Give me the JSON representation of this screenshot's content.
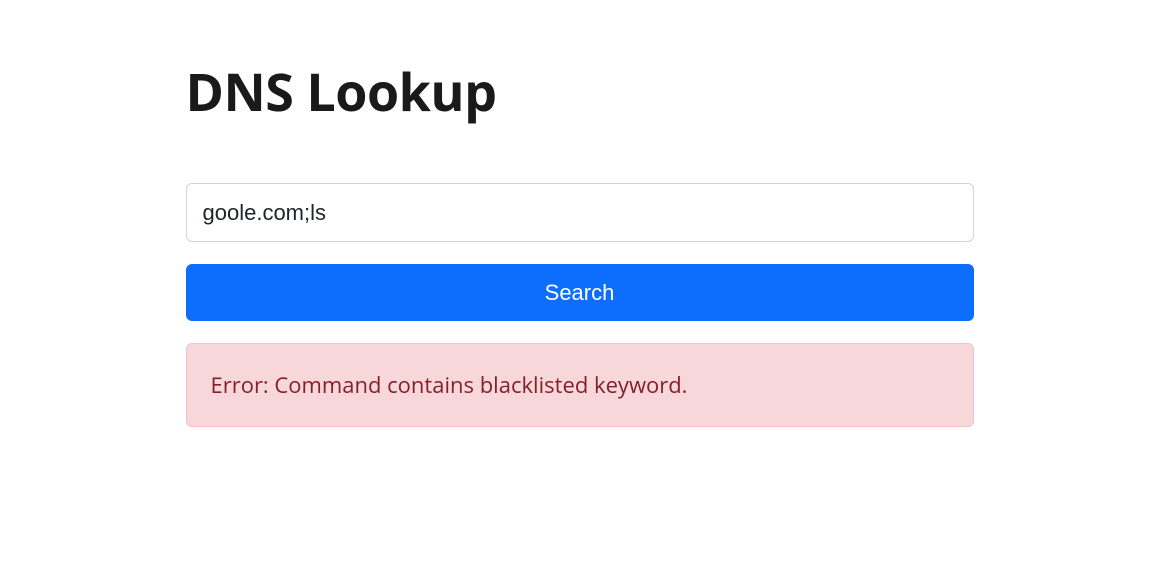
{
  "header": {
    "title": "DNS Lookup"
  },
  "search": {
    "value": "goole.com;ls",
    "button_label": "Search"
  },
  "alert": {
    "message": "Error: Command contains blacklisted keyword."
  }
}
